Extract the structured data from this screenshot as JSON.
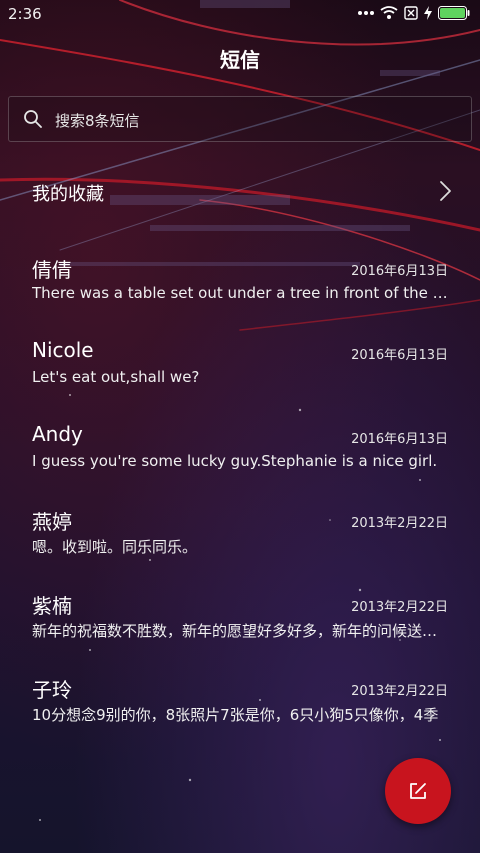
{
  "status_bar": {
    "time": "2:36",
    "icons": [
      "more-dots-icon",
      "wifi-icon",
      "no-sim-icon",
      "charging-icon",
      "battery-icon"
    ],
    "battery_color": "#5fd35f"
  },
  "header": {
    "title": "短信"
  },
  "search": {
    "placeholder": "搜索8条短信"
  },
  "favorites": {
    "label": "我的收藏",
    "icon": "chevron-right-icon"
  },
  "conversations": [
    {
      "name": "倩倩",
      "date": "2016年6月13日",
      "preview": "There was a table set out under a tree in front of the house"
    },
    {
      "name": "Nicole",
      "date": "2016年6月13日",
      "preview": "Let's eat out,shall we?"
    },
    {
      "name": "Andy",
      "date": "2016年6月13日",
      "preview": "I guess you're some lucky guy.Stephanie is a nice girl."
    },
    {
      "name": "燕婷",
      "date": "2013年2月22日",
      "preview": "嗯。收到啦。同乐同乐。"
    },
    {
      "name": "紫楠",
      "date": "2013年2月22日",
      "preview": "新年的祝福数不胜数，新年的愿望好多好多，新年的问候送给你"
    },
    {
      "name": "子玲",
      "date": "2013年2月22日",
      "preview": "10分想念9别的你，8张照片7张是你，6只小狗5只像你，4季"
    }
  ],
  "compose": {
    "icon": "compose-icon",
    "color": "#c8141e"
  }
}
